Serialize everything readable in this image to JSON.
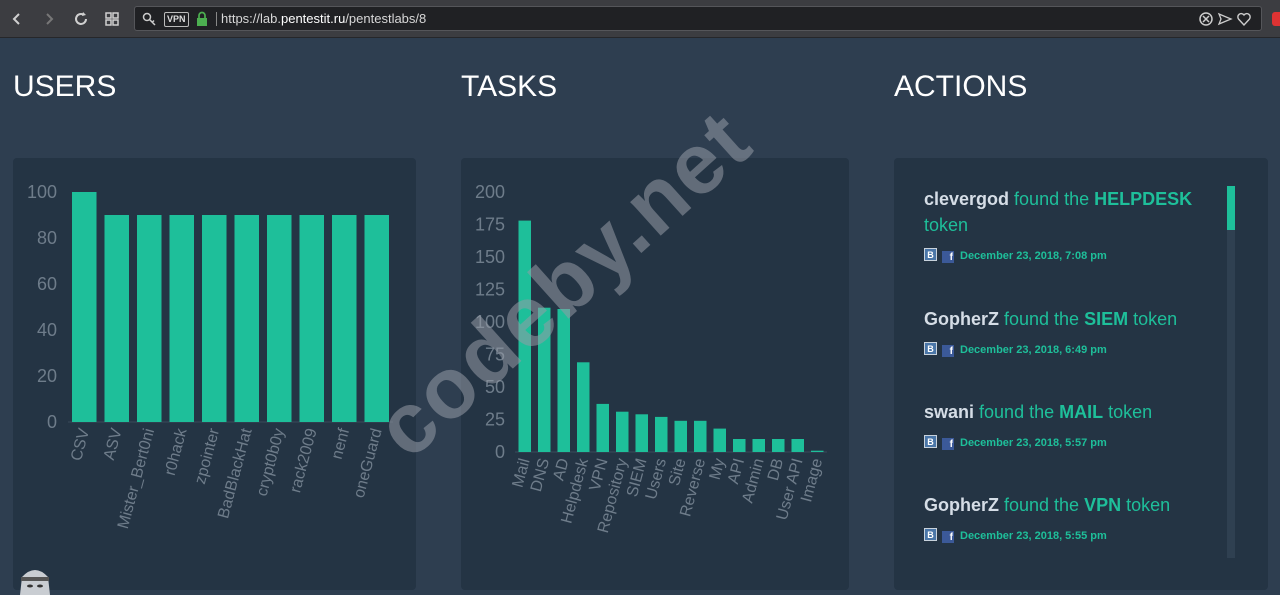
{
  "browser": {
    "vpn_badge": "VPN",
    "url_prefix": "https://lab.",
    "url_domain": "pentestit.ru",
    "url_path": "/pentestlabs/8"
  },
  "sections": {
    "users_title": "USERS",
    "tasks_title": "TASKS",
    "actions_title": "ACTIONS"
  },
  "chart_data": [
    {
      "type": "bar",
      "title": "USERS",
      "categories": [
        "CSV",
        "ASV",
        "Mister_Bert0ni",
        "r0hack",
        "zpointer",
        "BadBlackHat",
        "crypt0b0y",
        "rack2009",
        "nenf",
        "oneGuard"
      ],
      "values": [
        100,
        90,
        90,
        90,
        90,
        90,
        90,
        90,
        90,
        90
      ],
      "yticks": [
        0,
        20,
        40,
        60,
        80,
        100
      ],
      "ylim": [
        0,
        100
      ],
      "color": "#1ebf9a"
    },
    {
      "type": "bar",
      "title": "TASKS",
      "categories": [
        "Mail",
        "DNS",
        "AD",
        "Helpdesk",
        "VPN",
        "Repository",
        "SIEM",
        "Users",
        "Site",
        "Reverse",
        "My",
        "API",
        "Admin",
        "DB",
        "User API",
        "Image"
      ],
      "values": [
        178,
        111,
        110,
        69,
        37,
        31,
        29,
        27,
        24,
        24,
        18,
        10,
        10,
        10,
        10,
        1
      ],
      "yticks": [
        0,
        25,
        50,
        75,
        100,
        125,
        150,
        175,
        200
      ],
      "ylim": [
        0,
        200
      ],
      "color": "#1ebf9a"
    }
  ],
  "actions": [
    {
      "user": "clevergod",
      "found": " found the ",
      "task": "HELPDESK",
      "suffix": " token",
      "date": "December 23, 2018, 7:08 pm"
    },
    {
      "user": "GopherZ",
      "found": " found the ",
      "task": "SIEM",
      "suffix": " token",
      "date": "December 23, 2018, 6:49 pm"
    },
    {
      "user": "swani",
      "found": " found the ",
      "task": "MAIL",
      "suffix": " token",
      "date": "December 23, 2018, 5:57 pm"
    },
    {
      "user": "GopherZ",
      "found": " found the ",
      "task": "VPN",
      "suffix": " token",
      "date": "December 23, 2018, 5:55 pm"
    }
  ],
  "icons": {
    "vk": "B",
    "fb": "f"
  },
  "watermark": "codeby.net",
  "colors": {
    "accent": "#1ebf9a",
    "background": "#2e3e50",
    "panel": "#243444"
  }
}
